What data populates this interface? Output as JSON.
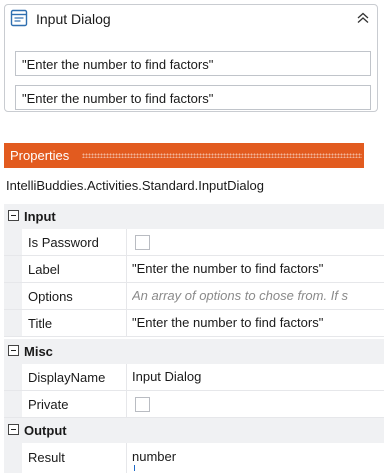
{
  "activity": {
    "title": "Input Dialog",
    "icon": "dialog-icon",
    "collapse_icon": "collapse-chevron-icon",
    "field_1_value": "\"Enter the number to find factors\"",
    "field_2_value": "\"Enter the number to find factors\""
  },
  "properties": {
    "header_title": "Properties",
    "header_color": "#e25b1f",
    "type_name": "IntelliBuddies.Activities.Standard.InputDialog",
    "categories": {
      "input": "Input",
      "misc": "Misc",
      "output": "Output"
    },
    "rows": {
      "is_password": {
        "name": "Is Password",
        "checked": false
      },
      "label": {
        "name": "Label",
        "value": "\"Enter the number to find factors\""
      },
      "options": {
        "name": "Options",
        "placeholder": "An array of options to chose from. If s"
      },
      "title": {
        "name": "Title",
        "value": "\"Enter the number to find factors\""
      },
      "display_name": {
        "name": "DisplayName",
        "value": "Input Dialog"
      },
      "private": {
        "name": "Private",
        "checked": false
      },
      "result": {
        "name": "Result",
        "value": "number"
      }
    }
  }
}
